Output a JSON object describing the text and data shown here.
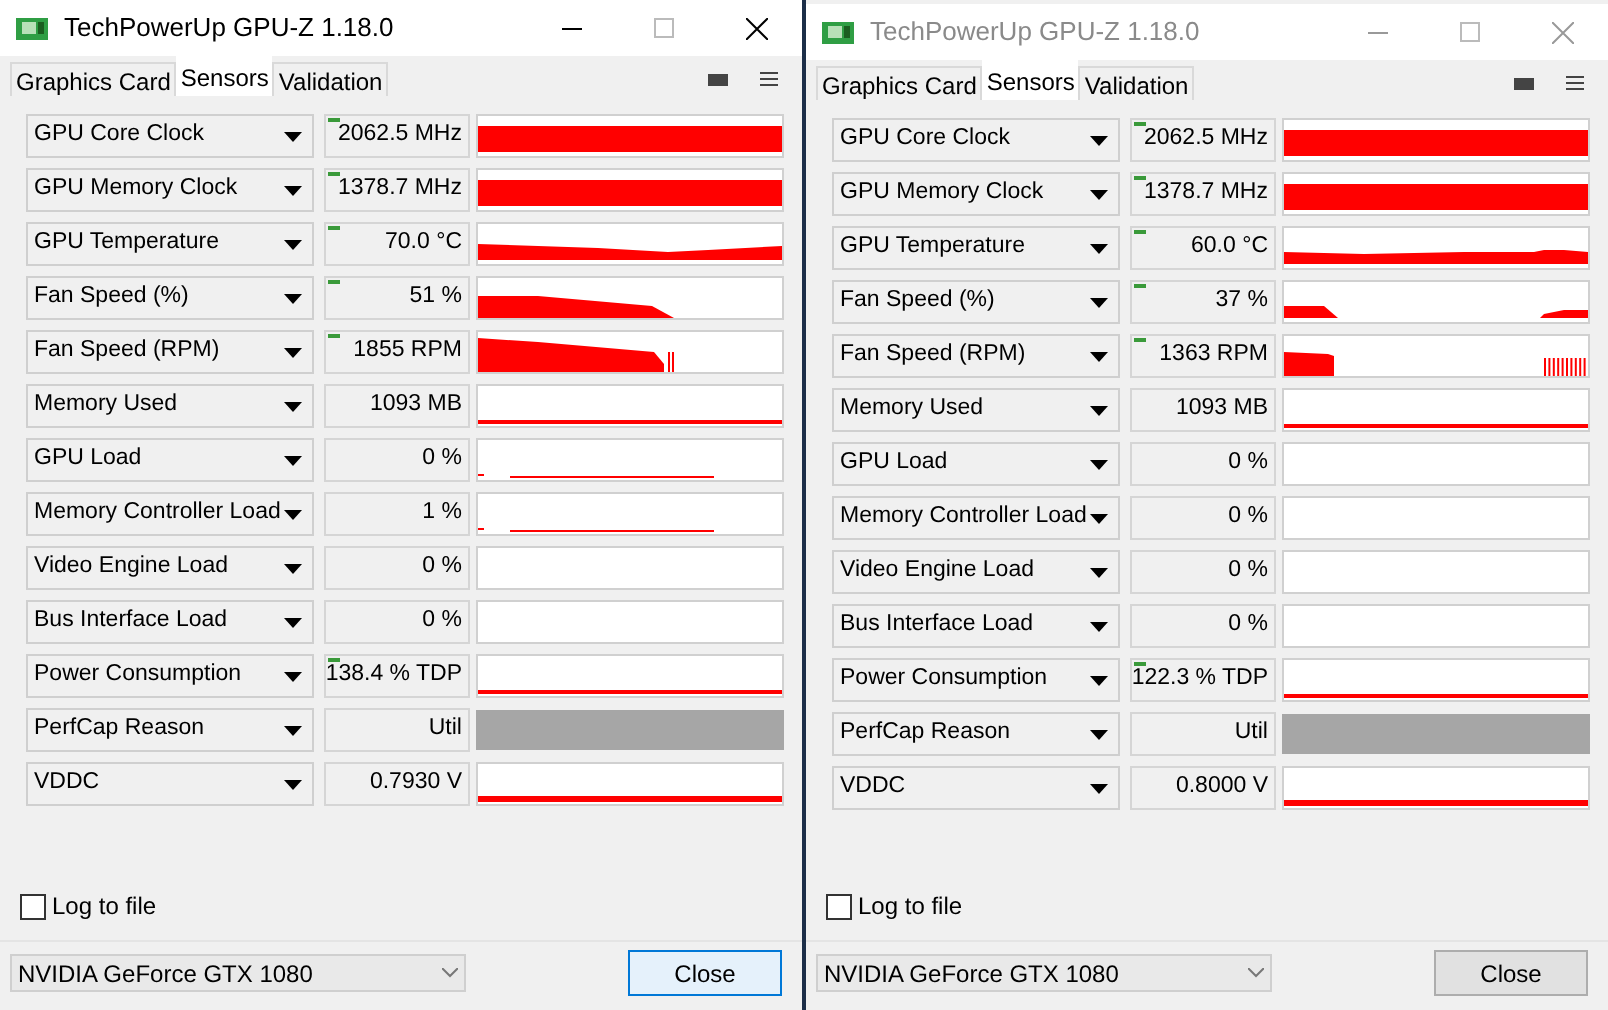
{
  "windows": [
    {
      "active": true,
      "title": "TechPowerUp GPU-Z 1.18.0",
      "tabs": [
        {
          "label": "Graphics Card",
          "selected": false
        },
        {
          "label": "Sensors",
          "selected": true
        },
        {
          "label": "Validation",
          "selected": false
        }
      ],
      "sensors": [
        {
          "name": "GPU Core Clock",
          "value": "2062.5 MHz",
          "max_marker": true,
          "kind": "full"
        },
        {
          "name": "GPU Memory Clock",
          "value": "1378.7 MHz",
          "max_marker": true,
          "kind": "full"
        },
        {
          "name": "GPU Temperature",
          "value": "70.0 °C",
          "max_marker": true,
          "kind": "temphigh"
        },
        {
          "name": "Fan Speed (%)",
          "value": "51 %",
          "max_marker": true,
          "kind": "fandrop"
        },
        {
          "name": "Fan Speed (RPM)",
          "value": "1855 RPM",
          "max_marker": true,
          "kind": "rpmdrop"
        },
        {
          "name": "Memory Used",
          "value": "1093 MB",
          "max_marker": false,
          "kind": "baseline"
        },
        {
          "name": "GPU Load",
          "value": "0 %",
          "max_marker": false,
          "kind": "faint"
        },
        {
          "name": "Memory Controller Load",
          "value": "1 %",
          "max_marker": false,
          "kind": "faint"
        },
        {
          "name": "Video Engine Load",
          "value": "0 %",
          "max_marker": false,
          "kind": "empty"
        },
        {
          "name": "Bus Interface Load",
          "value": "0 %",
          "max_marker": false,
          "kind": "empty"
        },
        {
          "name": "Power Consumption",
          "value": "138.4 % TDP",
          "max_marker": true,
          "kind": "baseline"
        },
        {
          "name": "PerfCap Reason",
          "value": "Util",
          "max_marker": false,
          "kind": "gray"
        },
        {
          "name": "VDDC",
          "value": "0.7930 V",
          "max_marker": false,
          "kind": "thick"
        }
      ],
      "log_to_file": {
        "label": "Log to file",
        "checked": false
      },
      "device": "NVIDIA GeForce GTX 1080",
      "close": "Close"
    },
    {
      "active": false,
      "title": "TechPowerUp GPU-Z 1.18.0",
      "tabs": [
        {
          "label": "Graphics Card",
          "selected": false
        },
        {
          "label": "Sensors",
          "selected": true
        },
        {
          "label": "Validation",
          "selected": false
        }
      ],
      "sensors": [
        {
          "name": "GPU Core Clock",
          "value": "2062.5 MHz",
          "max_marker": true,
          "kind": "full"
        },
        {
          "name": "GPU Memory Clock",
          "value": "1378.7 MHz",
          "max_marker": true,
          "kind": "full"
        },
        {
          "name": "GPU Temperature",
          "value": "60.0 °C",
          "max_marker": true,
          "kind": "templow"
        },
        {
          "name": "Fan Speed (%)",
          "value": "37 %",
          "max_marker": true,
          "kind": "fansplit"
        },
        {
          "name": "Fan Speed (RPM)",
          "value": "1363 RPM",
          "max_marker": true,
          "kind": "rpmsplit"
        },
        {
          "name": "Memory Used",
          "value": "1093 MB",
          "max_marker": false,
          "kind": "baseline"
        },
        {
          "name": "GPU Load",
          "value": "0 %",
          "max_marker": false,
          "kind": "empty"
        },
        {
          "name": "Memory Controller Load",
          "value": "0 %",
          "max_marker": false,
          "kind": "empty"
        },
        {
          "name": "Video Engine Load",
          "value": "0 %",
          "max_marker": false,
          "kind": "empty"
        },
        {
          "name": "Bus Interface Load",
          "value": "0 %",
          "max_marker": false,
          "kind": "empty"
        },
        {
          "name": "Power Consumption",
          "value": "122.3 % TDP",
          "max_marker": true,
          "kind": "baseline"
        },
        {
          "name": "PerfCap Reason",
          "value": "Util",
          "max_marker": false,
          "kind": "gray"
        },
        {
          "name": "VDDC",
          "value": "0.8000 V",
          "max_marker": false,
          "kind": "thick"
        }
      ],
      "log_to_file": {
        "label": "Log to file",
        "checked": false
      },
      "device": "NVIDIA GeForce GTX 1080",
      "close": "Close"
    }
  ]
}
